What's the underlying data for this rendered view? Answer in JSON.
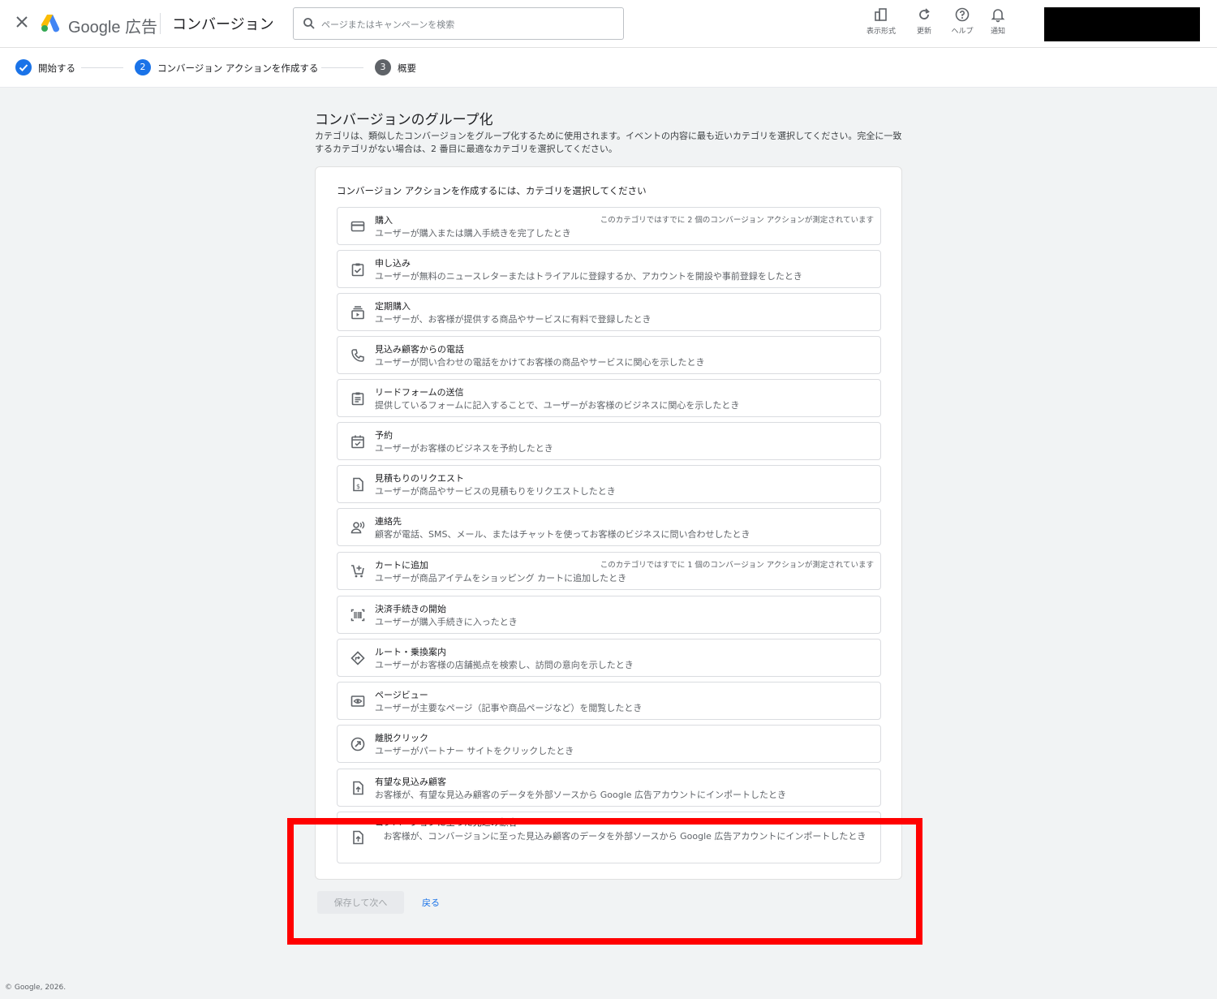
{
  "header": {
    "brand": "Google 広告",
    "page_title": "コンバージョン",
    "search_placeholder": "ページまたはキャンペーンを検索",
    "tools": {
      "appearance": "表示形式",
      "refresh": "更新",
      "help": "ヘルプ",
      "notifications": "通知"
    }
  },
  "stepper": {
    "steps": [
      {
        "number": "",
        "label": "開始する",
        "state": "completed"
      },
      {
        "number": "2",
        "label": "コンバージョン アクションを作成する",
        "state": "active"
      },
      {
        "number": "3",
        "label": "概要",
        "state": "upcoming"
      }
    ]
  },
  "main": {
    "title": "コンバージョンのグループ化",
    "description": "カテゴリは、類似したコンバージョンをグループ化するために使用されます。イベントの内容に最も近いカテゴリを選択してください。完全に一致するカテゴリがない場合は、2 番目に最適なカテゴリを選択してください。",
    "card_heading": "コンバージョン アクションを作成するには、カテゴリを選択してください"
  },
  "categories": [
    {
      "icon": "credit-card-icon",
      "title": "購入",
      "desc": "ユーザーが購入または購入手続きを完了したとき",
      "note": "このカテゴリではすでに 2 個のコンバージョン アクションが測定されています"
    },
    {
      "icon": "checklist-icon",
      "title": "申し込み",
      "desc": "ユーザーが無料のニュースレターまたはトライアルに登録するか、アカウントを開設や事前登録をしたとき",
      "note": ""
    },
    {
      "icon": "subscriptions-icon",
      "title": "定期購入",
      "desc": "ユーザーが、お客様が提供する商品やサービスに有料で登録したとき",
      "note": ""
    },
    {
      "icon": "phone-icon",
      "title": "見込み顧客からの電話",
      "desc": "ユーザーが問い合わせの電話をかけてお客様の商品やサービスに関心を示したとき",
      "note": ""
    },
    {
      "icon": "clipboard-icon",
      "title": "リードフォームの送信",
      "desc": "提供しているフォームに記入することで、ユーザーがお客様のビジネスに関心を示したとき",
      "note": ""
    },
    {
      "icon": "calendar-check-icon",
      "title": "予約",
      "desc": "ユーザーがお客様のビジネスを予約したとき",
      "note": ""
    },
    {
      "icon": "quote-document-icon",
      "title": "見積もりのリクエスト",
      "desc": "ユーザーが商品やサービスの見積もりをリクエストしたとき",
      "note": ""
    },
    {
      "icon": "contacts-icon",
      "title": "連絡先",
      "desc": "顧客が電話、SMS、メール、またはチャットを使ってお客様のビジネスに問い合わせしたとき",
      "note": ""
    },
    {
      "icon": "add-to-cart-icon",
      "title": "カートに追加",
      "desc": "ユーザーが商品アイテムをショッピング カートに追加したとき",
      "note": "このカテゴリではすでに 1 個のコンバージョン アクションが測定されています"
    },
    {
      "icon": "barcode-icon",
      "title": "決済手続きの開始",
      "desc": "ユーザーが購入手続きに入ったとき",
      "note": ""
    },
    {
      "icon": "directions-icon",
      "title": "ルート・乗換案内",
      "desc": "ユーザーがお客様の店舗拠点を検索し、訪問の意向を示したとき",
      "note": ""
    },
    {
      "icon": "page-view-icon",
      "title": "ページビュー",
      "desc": "ユーザーが主要なページ（記事や商品ページなど）を閲覧したとき",
      "note": ""
    },
    {
      "icon": "outbound-click-icon",
      "title": "離脱クリック",
      "desc": "ユーザーがパートナー サイトをクリックしたとき",
      "note": ""
    },
    {
      "icon": "upload-file-icon",
      "title": "有望な見込み顧客",
      "desc": "お客様が、有望な見込み顧客のデータを外部ソースから Google 広告アカウントにインポートしたとき",
      "note": ""
    },
    {
      "icon": "upload-file-icon",
      "title": "コンバージョンに至った見込み顧客",
      "desc": "お客様が、コンバージョンに至った見込み顧客のデータを外部ソースから Google 広告アカウントにインポートしたとき",
      "note": ""
    }
  ],
  "actions": {
    "save_next": "保存して次へ",
    "back": "戻る"
  },
  "footer": {
    "copyright": "© Google, 2026."
  },
  "colors": {
    "accent": "#1a73e8",
    "highlight": "#ff0000",
    "background": "#f1f3f4"
  }
}
